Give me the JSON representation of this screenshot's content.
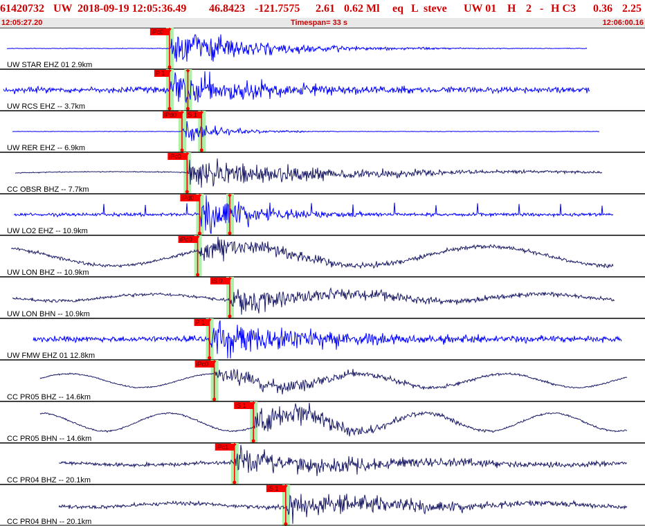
{
  "header": {
    "event_id": "61420732",
    "network": "UW",
    "datetime": "2018-09-19 12:05:36.49",
    "lat": "46.8423",
    "lon": "-121.7575",
    "depth": "2.61",
    "magnitude": "0.62 Ml",
    "etype": "eq",
    "type": "L",
    "analyst": "steve",
    "auth": "UW 01",
    "quality": "H",
    "code1": "2",
    "dash": "-",
    "code2": "H C3",
    "rms": "0.36",
    "erh": "2.25"
  },
  "subheader": {
    "start_time": "12:05:27.20",
    "timespan": "Timespan=  33 s",
    "end_time": "12:06:00.16"
  },
  "colors": {
    "header_text": "#d00000",
    "trace_bright": "#0000ff",
    "trace_dark": "#1a1a66",
    "pick_flag": "#ff0000",
    "window_highlight": "#aef0a8"
  },
  "channels": [
    {
      "label": "UW STAR EHZ 01 2.9km",
      "color": "bright",
      "style": "star",
      "picks": [
        {
          "text": "iPc0",
          "t": 8.66,
          "type": "P"
        }
      ]
    },
    {
      "label": "UW RCS EHZ -- 3.7km",
      "color": "bright",
      "style": "noisy",
      "picks": [
        {
          "text": "P 1",
          "t": 8.66,
          "type": "P"
        },
        {
          "text": "",
          "t": 9.6,
          "type": "S"
        }
      ]
    },
    {
      "label": "UW RER EHZ -- 6.9km",
      "color": "bright",
      "style": "rer",
      "picks": [
        {
          "text": "iPd0",
          "t": 9.3,
          "type": "P"
        },
        {
          "text": "S 1",
          "t": 10.3,
          "type": "S"
        }
      ]
    },
    {
      "label": "CC OBSR BHZ -- 7.7km",
      "color": "dark",
      "style": "obsr",
      "picks": [
        {
          "text": "iPc0",
          "t": 9.56,
          "type": "P"
        }
      ]
    },
    {
      "label": "UW LO2 EHZ -- 10.9km",
      "color": "bright",
      "style": "lo2",
      "picks": [
        {
          "text": "iPd0",
          "t": 10.2,
          "type": "P"
        },
        {
          "text": "",
          "t": 11.74,
          "type": "S"
        }
      ]
    },
    {
      "label": "UW LON BHZ -- 10.9km",
      "color": "dark",
      "style": "lon",
      "picks": [
        {
          "text": "iPd0",
          "t": 10.1,
          "type": "P"
        }
      ]
    },
    {
      "label": "UW LON BHN -- 10.9km",
      "color": "dark",
      "style": "lonn",
      "picks": [
        {
          "text": "iS 0",
          "t": 11.74,
          "type": "S"
        }
      ]
    },
    {
      "label": "UW FMW EHZ 01 12.8km",
      "color": "bright",
      "style": "fmw",
      "picks": [
        {
          "text": "P 1",
          "t": 10.7,
          "type": "P"
        }
      ]
    },
    {
      "label": "CC PR05 BHZ -- 14.6km",
      "color": "dark",
      "style": "pr05z",
      "picks": [
        {
          "text": "iPc0",
          "t": 10.95,
          "type": "P"
        }
      ]
    },
    {
      "label": "CC PR05 BHN -- 14.6km",
      "color": "dark",
      "style": "pr05n",
      "picks": [
        {
          "text": "iS 1",
          "t": 12.95,
          "type": "S"
        }
      ]
    },
    {
      "label": "CC PR04 BHZ -- 20.1km",
      "color": "dark",
      "style": "pr04z",
      "picks": [
        {
          "text": "iPc1",
          "t": 11.98,
          "type": "P"
        }
      ]
    },
    {
      "label": "CC PR04 BHN -- 20.1km",
      "color": "dark",
      "style": "pr04n",
      "picks": [
        {
          "text": "iS 1",
          "t": 14.6,
          "type": "S"
        }
      ]
    }
  ]
}
